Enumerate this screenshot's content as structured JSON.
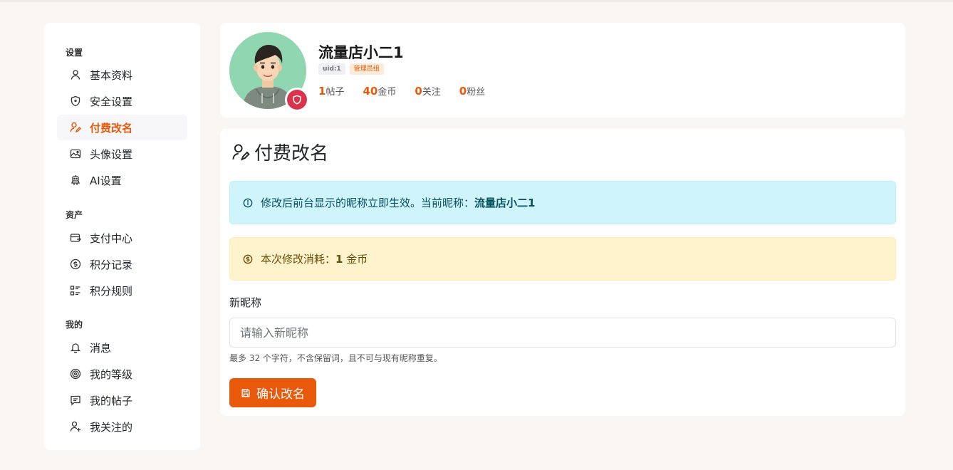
{
  "theme": {
    "accent": "#e8590c",
    "danger": "#d9344b",
    "info_bg": "#cff4fc",
    "warn_bg": "#fff3cd"
  },
  "sidebar": {
    "sections": [
      {
        "title": "设置",
        "items": [
          {
            "label": "基本资料",
            "icon": "user-icon"
          },
          {
            "label": "安全设置",
            "icon": "shield-icon"
          },
          {
            "label": "付费改名",
            "icon": "user-edit-icon",
            "active": true
          },
          {
            "label": "头像设置",
            "icon": "image-icon"
          },
          {
            "label": "AI设置",
            "icon": "robot-icon"
          }
        ]
      },
      {
        "title": "资产",
        "items": [
          {
            "label": "支付中心",
            "icon": "wallet-icon"
          },
          {
            "label": "积分记录",
            "icon": "coin-icon"
          },
          {
            "label": "积分规则",
            "icon": "list-icon"
          }
        ]
      },
      {
        "title": "我的",
        "items": [
          {
            "label": "消息",
            "icon": "bell-icon"
          },
          {
            "label": "我的等级",
            "icon": "level-icon"
          },
          {
            "label": "我的帖子",
            "icon": "message-icon"
          },
          {
            "label": "我关注的",
            "icon": "user-plus-icon"
          }
        ]
      }
    ]
  },
  "profile": {
    "name": "流量店小二1",
    "uid_tag": "uid:1",
    "group_tag": "管理员组",
    "stats": [
      {
        "num": "1",
        "label": "帖子"
      },
      {
        "num": "40",
        "label": "金币"
      },
      {
        "num": "0",
        "label": "关注"
      },
      {
        "num": "0",
        "label": "粉丝"
      }
    ]
  },
  "main": {
    "title": "付费改名",
    "info_text": "修改后前台显示的昵称立即生效。当前昵称：",
    "info_current": "流量店小二1",
    "cost_prefix": "本次修改消耗：",
    "cost_amount": "1",
    "cost_unit": "金币",
    "field_label": "新昵称",
    "input_placeholder": "请输入新昵称",
    "input_value": "",
    "hint": "最多 32 个字符，不含保留词，且不可与现有昵称重复。",
    "confirm_label": "确认改名"
  }
}
